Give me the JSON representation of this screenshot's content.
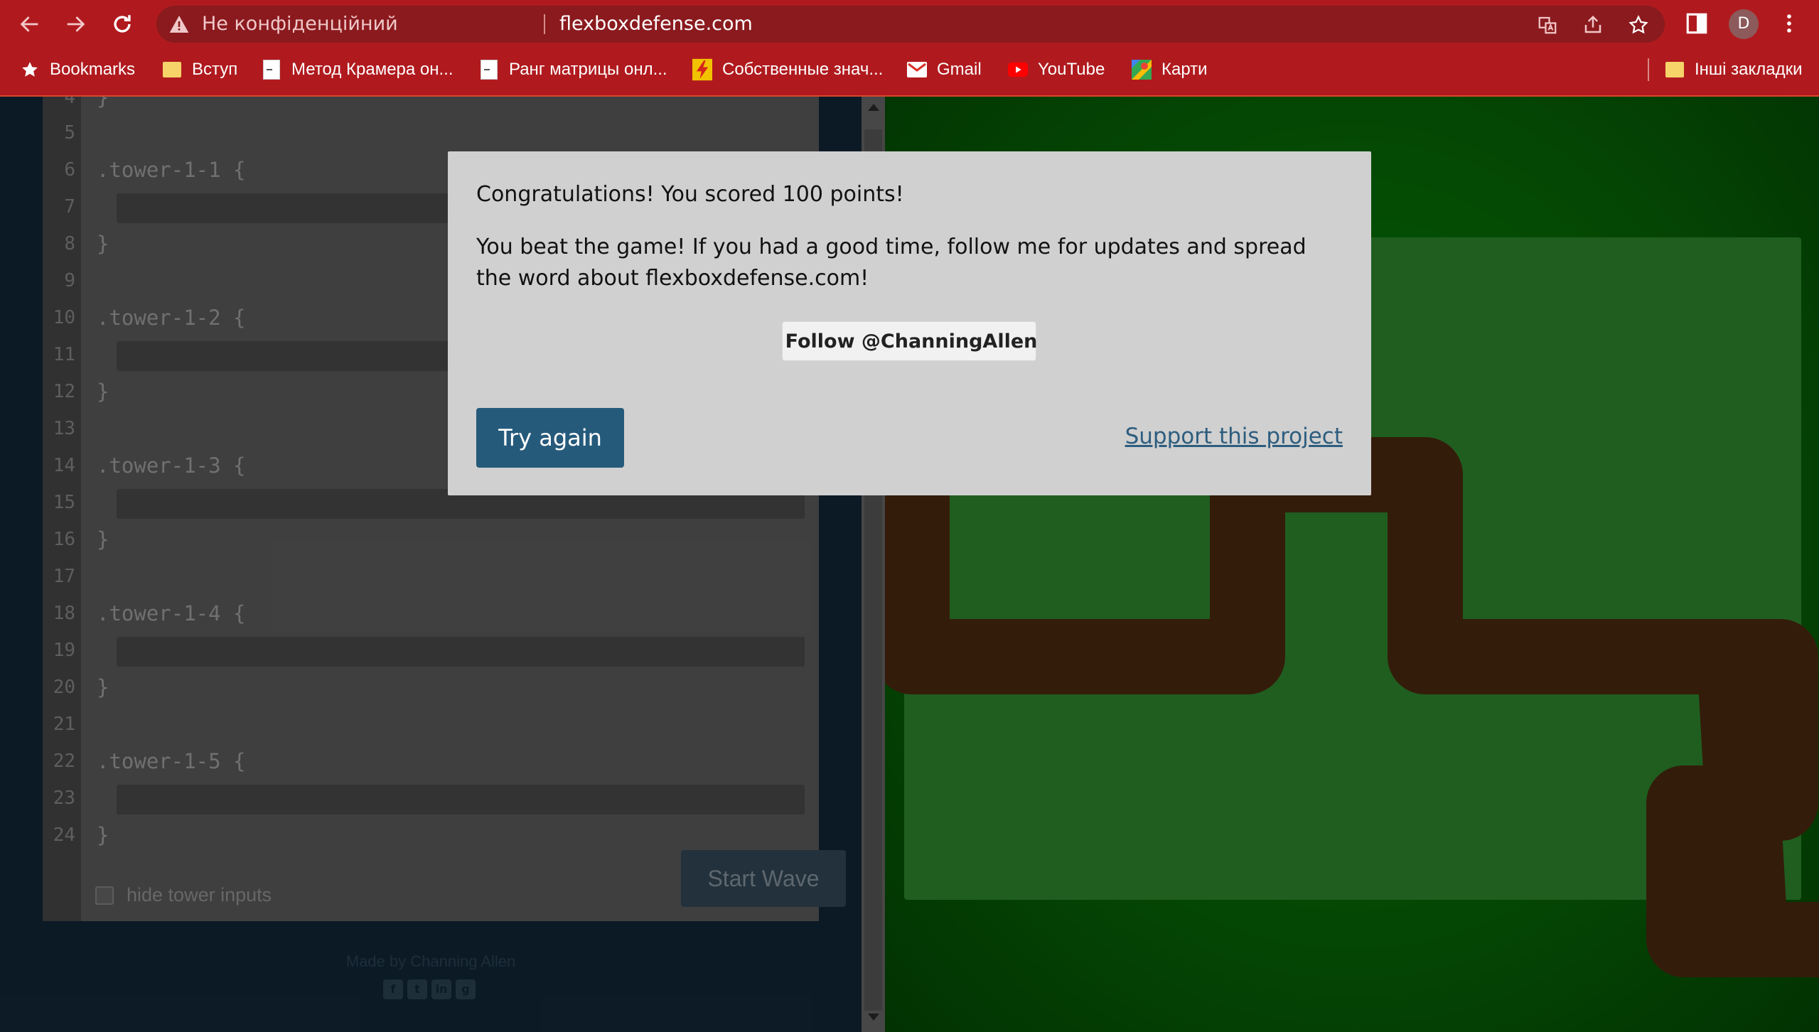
{
  "browser": {
    "security_label": "Не конфіденційний",
    "url": "flexboxdefense.com",
    "profile_initial": "D",
    "bookmarks": [
      {
        "label": "Bookmarks",
        "icon": "star-icon"
      },
      {
        "label": "Вступ",
        "icon": "folder-icon"
      },
      {
        "label": "Метод Крамера он...",
        "icon": "page-icon"
      },
      {
        "label": "Ранг матрицы онл...",
        "icon": "page-icon"
      },
      {
        "label": "Собственные знач...",
        "icon": "bolt-icon"
      },
      {
        "label": "Gmail",
        "icon": "gmail-icon"
      },
      {
        "label": "YouTube",
        "icon": "youtube-icon"
      },
      {
        "label": "Карти",
        "icon": "maps-icon"
      }
    ],
    "other_bookmarks": "Інші закладки"
  },
  "editor": {
    "line_numbers": [
      "4",
      "5",
      "6",
      "7",
      "8",
      "9",
      "10",
      "11",
      "12",
      "13",
      "14",
      "15",
      "16",
      "17",
      "18",
      "19",
      "20",
      "21",
      "22",
      "23",
      "24"
    ],
    "code_lines": {
      "l4": "}",
      "l6": ".tower-1-1 {",
      "l8": "}",
      "l10": ".tower-1-2 {",
      "l12": "}",
      "l14": ".tower-1-3 {",
      "l16": "}",
      "l18": ".tower-1-4 {",
      "l20": "}",
      "l22": ".tower-1-5 {",
      "l24": "}"
    },
    "hide_inputs_label": "hide tower inputs",
    "start_wave_label": "Start Wave"
  },
  "footer": {
    "credit": "Made by Channing Allen",
    "socials": [
      "facebook-icon",
      "twitter-icon",
      "linkedin-icon",
      "github-icon"
    ]
  },
  "modal": {
    "congrats": "Congratulations! You scored 100 points!",
    "message": "You beat the game! If you had a good time, follow me for updates and spread the word about flexboxdefense.com!",
    "follow_label": "Follow @ChanningAllen",
    "try_again_label": "Try again",
    "support_label": "Support this project"
  },
  "colors": {
    "chrome": "#b01a1e",
    "modal_bg": "#d0d0d0",
    "primary_button": "#255a7b",
    "board_grass": "#066806",
    "path": "#4e2a10"
  }
}
